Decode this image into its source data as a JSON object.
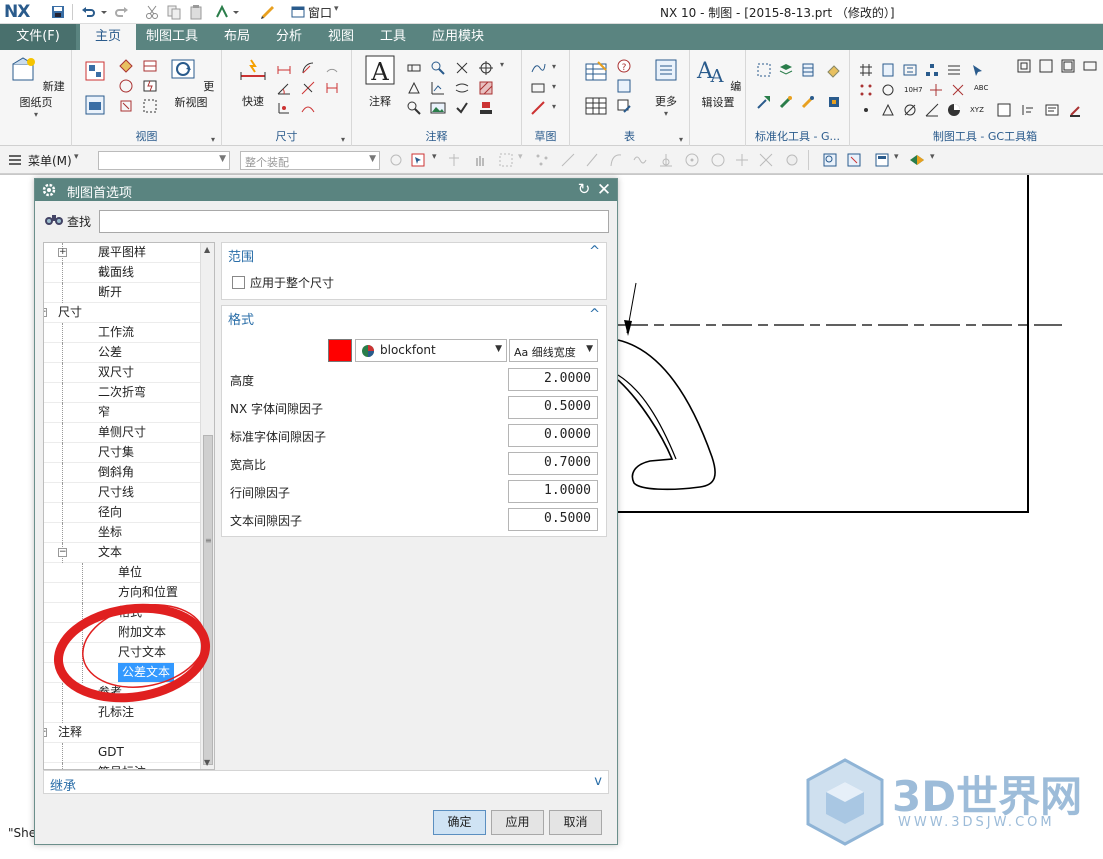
{
  "app": {
    "logo": "NX",
    "window_title": "NX 10 - 制图 - [2015-8-13.prt （修改的）]",
    "quick_access": {
      "window_menu": "窗口"
    }
  },
  "ribbon": {
    "file_tab": "文件(F)",
    "tabs": [
      "主页",
      "制图工具",
      "布局",
      "分析",
      "视图",
      "工具",
      "应用模块"
    ],
    "active_tab": "主页",
    "buttons": {
      "new_sheet": "新建图纸页",
      "update_view": "更新视图",
      "rapid": "快速",
      "note": "注释",
      "more": "更多",
      "edit_settings": "编辑设置"
    },
    "group_labels": {
      "view": "视图",
      "dimension": "尺寸",
      "annotation": "注释",
      "sketch": "草图",
      "table": "表",
      "std_tools": "标准化工具 - G...",
      "gc_toolbox": "制图工具 - GC工具箱"
    },
    "small_labels": {
      "tol_10h7": "10H7",
      "abc": "ABC",
      "xyz": "XYZ"
    }
  },
  "toolbar2": {
    "menu_label": "菜单(M)",
    "combo1": "",
    "assembly_combo": "整个装配"
  },
  "dialog": {
    "title": "制图首选项",
    "find_label": "查找",
    "find_value": "",
    "tree": [
      {
        "label": "展平图样",
        "level": 1,
        "expander": "+"
      },
      {
        "label": "截面线",
        "level": 1
      },
      {
        "label": "断开",
        "level": 1
      },
      {
        "label": "尺寸",
        "level": 0,
        "expander": "−"
      },
      {
        "label": "工作流",
        "level": 1
      },
      {
        "label": "公差",
        "level": 1
      },
      {
        "label": "双尺寸",
        "level": 1
      },
      {
        "label": "二次折弯",
        "level": 1
      },
      {
        "label": "窄",
        "level": 1
      },
      {
        "label": "单侧尺寸",
        "level": 1
      },
      {
        "label": "尺寸集",
        "level": 1
      },
      {
        "label": "倒斜角",
        "level": 1
      },
      {
        "label": "尺寸线",
        "level": 1
      },
      {
        "label": "径向",
        "level": 1
      },
      {
        "label": "坐标",
        "level": 1
      },
      {
        "label": "文本",
        "level": 1,
        "expander": "−"
      },
      {
        "label": "单位",
        "level": 2
      },
      {
        "label": "方向和位置",
        "level": 2
      },
      {
        "label": "格式",
        "level": 2
      },
      {
        "label": "附加文本",
        "level": 2
      },
      {
        "label": "尺寸文本",
        "level": 2
      },
      {
        "label": "公差文本",
        "level": 2,
        "selected": true
      },
      {
        "label": "参考",
        "level": 1
      },
      {
        "label": "孔标注",
        "level": 1
      },
      {
        "label": "注释",
        "level": 0,
        "expander": "−"
      },
      {
        "label": "GDT",
        "level": 1
      },
      {
        "label": "符号标注",
        "level": 1
      }
    ],
    "scope": {
      "header": "范围",
      "apply_all_label": "应用于整个尺寸",
      "apply_all_checked": false
    },
    "format": {
      "header": "格式",
      "color": "#ff0000",
      "font": "blockfont",
      "line_width": "Aa 细线宽度",
      "rows": [
        {
          "label": "高度",
          "value": "2.0000"
        },
        {
          "label": "NX 字体间隙因子",
          "value": "0.5000"
        },
        {
          "label": "标准字体间隙因子",
          "value": "0.0000"
        },
        {
          "label": "宽高比",
          "value": "0.7000"
        },
        {
          "label": "行间隙因子",
          "value": "1.0000"
        },
        {
          "label": "文本间隙因子",
          "value": "0.5000"
        }
      ]
    },
    "inherit_header": "继承",
    "buttons": {
      "ok": "确定",
      "apply": "应用",
      "cancel": "取消"
    }
  },
  "status_text": "\"She",
  "watermark": {
    "brand": "3D世界网",
    "url": "WWW.3DSJW.COM"
  },
  "colors": {
    "teal": "#5a8480",
    "accent_blue": "#2a6ea8",
    "selection": "#3399ff",
    "highlight_circle": "#e02020"
  }
}
